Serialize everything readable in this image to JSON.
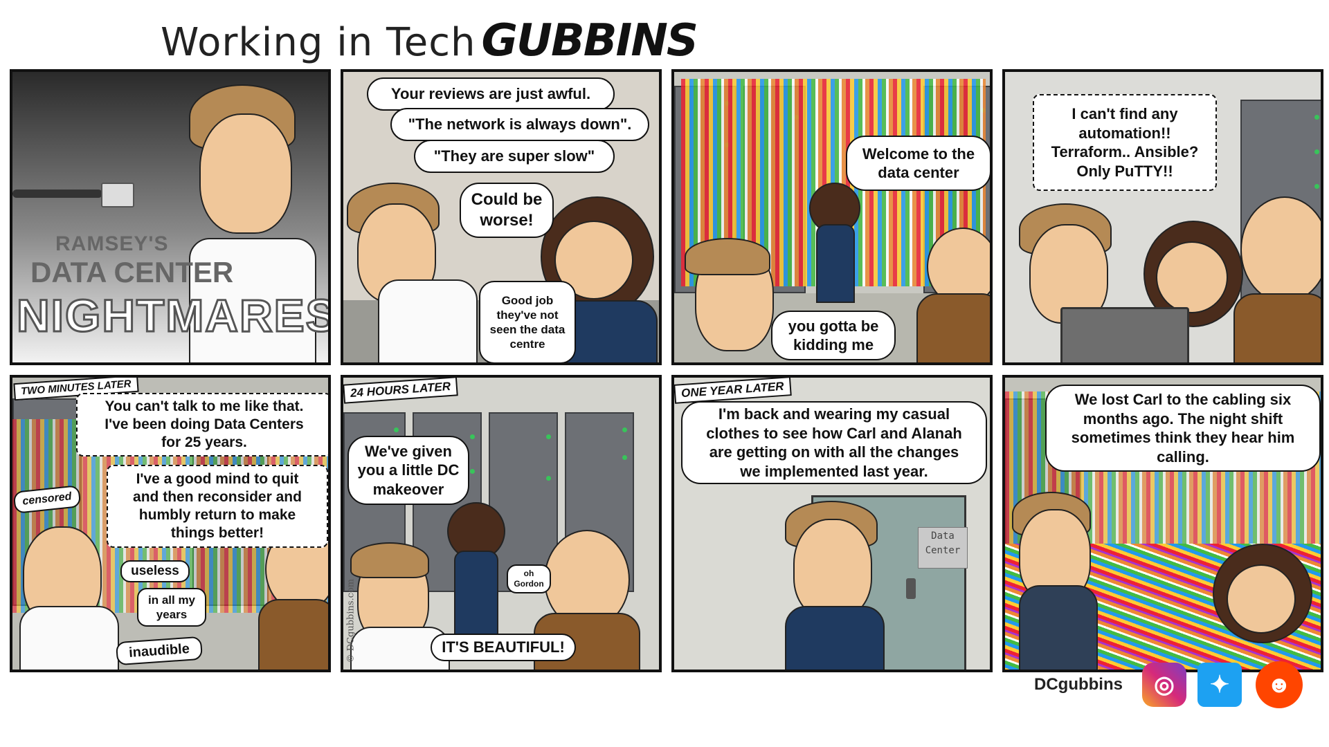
{
  "header": {
    "title": "Working in Tech",
    "brand": "GUBBINS"
  },
  "panels": {
    "p1": {
      "line1": "RAMSEY'S",
      "line2": "DATA CENTER",
      "line3": "NIGHTMARES"
    },
    "p2": {
      "b1": "Your reviews are just awful.",
      "b2": "\"The network is always down\".",
      "b3": "\"They are super slow\"",
      "b4": "Could be\nworse!",
      "b5": "Good job\nthey've not\nseen the data\ncentre"
    },
    "p3": {
      "b1": "Welcome to the\ndata center",
      "b2": "you gotta be\nkidding me"
    },
    "p4": {
      "b1": "I can't find any\nautomation!!\nTerraform.. Ansible?\nOnly PuTTY!!"
    },
    "p5": {
      "caption": "TWO MINUTES LATER",
      "b1": "You can't talk to me like that.\nI've been doing Data Centers\nfor 25 years.",
      "b2": "I've a good mind to quit\nand then reconsider and\nhumbly return to make\nthings better!",
      "t1": "censored",
      "t2": "useless",
      "t3": "in all my\nyears",
      "t4": "inaudible"
    },
    "p6": {
      "caption": "24 HOURS LATER",
      "b1": "We've given\nyou a little DC\nmakeover",
      "b2": "oh\nGordon",
      "b3": "IT'S BEAUTIFUL!",
      "copyright": "© DCgubbins.com"
    },
    "p7": {
      "caption": "ONE YEAR LATER",
      "b1": "I'm back and wearing my casual\nclothes to see how Carl and Alanah\nare getting on with all the changes\nwe implemented last year.",
      "door": "Data\nCenter"
    },
    "p8": {
      "b1": "We lost Carl to the cabling six\nmonths ago. The night shift\nsometimes think they hear him\ncalling."
    }
  },
  "footer": {
    "handle": "DCgubbins",
    "icons": [
      "instagram-icon",
      "twitter-icon",
      "reddit-icon"
    ]
  },
  "colors": {
    "instagram": "#d6297a",
    "twitter": "#1da1f2",
    "reddit": "#ff4500"
  }
}
